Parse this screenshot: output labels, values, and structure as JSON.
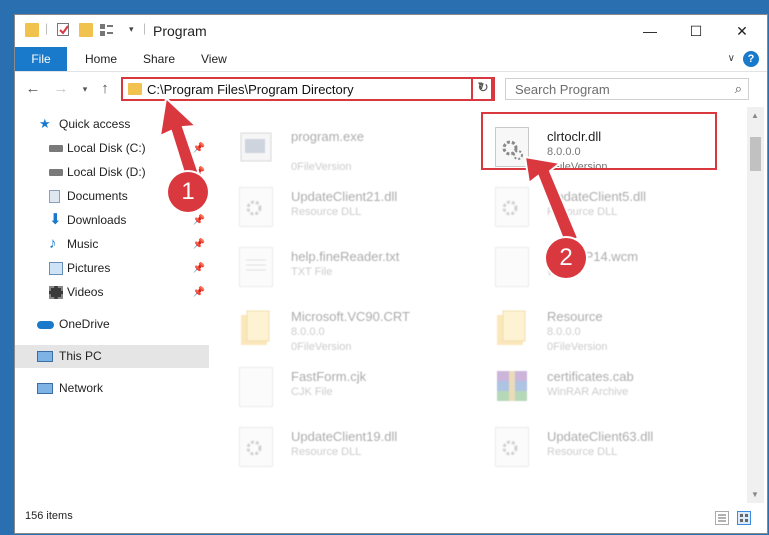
{
  "window": {
    "title": "Program"
  },
  "ribbon": {
    "tabs": [
      "File",
      "Home",
      "Share",
      "View"
    ],
    "help": "?"
  },
  "address": {
    "path": "C:\\Program Files\\Program Directory"
  },
  "search": {
    "placeholder": "Search Program"
  },
  "sidebar": {
    "items": [
      {
        "label": "Quick access",
        "icon": "star-icon"
      },
      {
        "label": "Local Disk (C:)",
        "icon": "drive-icon"
      },
      {
        "label": "Local Disk (D:)",
        "icon": "drive-icon"
      },
      {
        "label": "Documents",
        "icon": "documents-icon"
      },
      {
        "label": "Downloads",
        "icon": "download-icon"
      },
      {
        "label": "Music",
        "icon": "music-icon"
      },
      {
        "label": "Pictures",
        "icon": "pictures-icon"
      },
      {
        "label": "Videos",
        "icon": "videos-icon"
      },
      {
        "label": "OneDrive",
        "icon": "cloud-icon"
      },
      {
        "label": "This PC",
        "icon": "computer-icon"
      },
      {
        "label": "Network",
        "icon": "network-icon"
      }
    ]
  },
  "files": [
    {
      "name": "program.exe",
      "line2": "",
      "line3": "0FileVersion",
      "icon": "exe-icon"
    },
    {
      "name": "clrtoclr.dll",
      "line2": "8.0.0.0",
      "line3": "0FileVersion",
      "icon": "dll-gear-icon"
    },
    {
      "name": "UpdateClient21.dll",
      "line2": "Resource DLL",
      "line3": "",
      "icon": "dll-gear-icon"
    },
    {
      "name": "UpdateClient5.dll",
      "line2": "Resource DLL",
      "line3": "",
      "icon": "dll-gear-icon"
    },
    {
      "name": "help.fineReader.txt",
      "line2": "TXT File",
      "line3": "",
      "icon": "text-file-icon"
    },
    {
      "name": "Sn...MP14.wcm",
      "line2": "WCM",
      "line3": "",
      "icon": "generic-file-icon"
    },
    {
      "name": "Microsoft.VC90.CRT",
      "line2": "8.0.0.0",
      "line3": "0FileVersion",
      "icon": "folder-icon"
    },
    {
      "name": "Resource",
      "line2": "8.0.0.0",
      "line3": "0FileVersion",
      "icon": "folder-icon"
    },
    {
      "name": "FastForm.cjk",
      "line2": "CJK File",
      "line3": "",
      "icon": "generic-file-icon"
    },
    {
      "name": "certificates.cab",
      "line2": "WinRAR Archive",
      "line3": "",
      "icon": "winrar-icon"
    },
    {
      "name": "UpdateClient19.dll",
      "line2": "Resource DLL",
      "line3": "",
      "icon": "dll-gear-icon"
    },
    {
      "name": "UpdateClient63.dll",
      "line2": "Resource DLL",
      "line3": "",
      "icon": "dll-gear-icon"
    }
  ],
  "status": {
    "count": "156 items"
  },
  "callouts": [
    "1",
    "2"
  ],
  "colors": {
    "accent": "#1979ca",
    "highlight": "#d9383f",
    "folder": "#f2c24f"
  }
}
